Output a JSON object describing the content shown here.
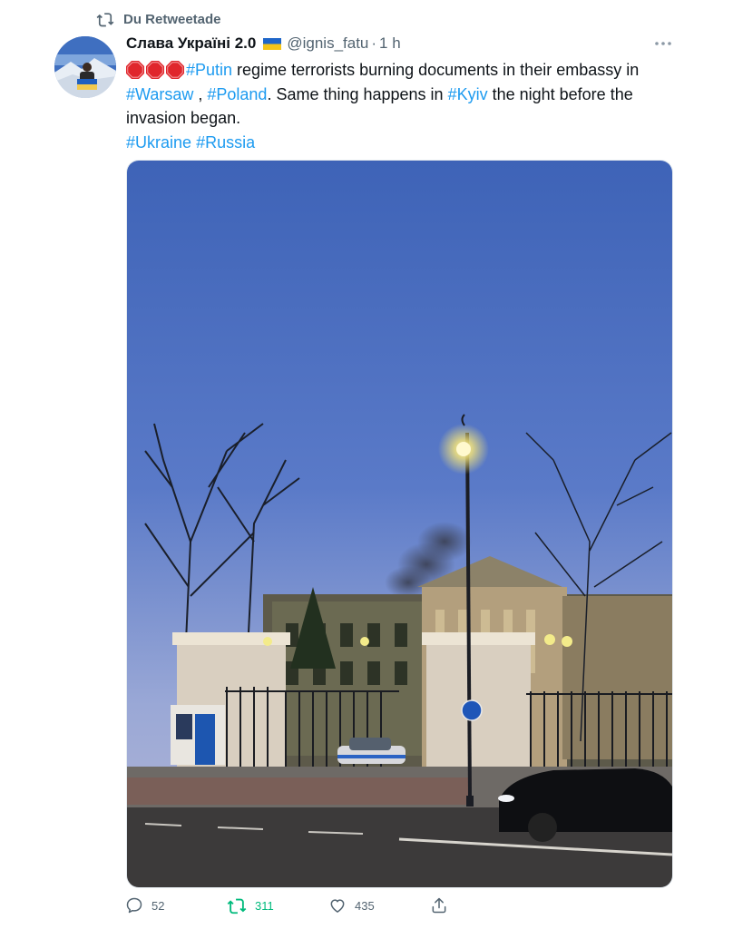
{
  "retweet_banner": {
    "icon": "retweet-icon",
    "label": "Du Retweetade"
  },
  "author": {
    "display_name": "Слава Україні 2.0",
    "flag_icon": "ukraine-flag-icon",
    "handle": "@ignis_fatu",
    "separator": "·",
    "time": "1 h",
    "avatar_icon": "avatar"
  },
  "tweet": {
    "lead_icons": [
      "stop-sign-icon",
      "stop-sign-icon",
      "stop-sign-icon"
    ],
    "line1": {
      "tag_putin": "#Putin",
      "text_a": " regime terrorists burning documents in their embassy in ",
      "tag_warsaw": "#Warsaw",
      "text_b": " , ",
      "tag_poland": "#Poland",
      "text_c": ". Same thing happens in ",
      "tag_kyiv": "#Kyiv",
      "text_d": " the night before the invasion began."
    },
    "line2": {
      "tag_ukraine": "#Ukraine",
      "space": " ",
      "tag_russia": "#Russia"
    }
  },
  "actions": {
    "replies": "52",
    "retweets": "311",
    "likes": "435"
  },
  "colors": {
    "link": "#1d9bf0",
    "muted": "#536471",
    "retweet_active": "#00ba7c",
    "stop_red": "#e0262c"
  }
}
